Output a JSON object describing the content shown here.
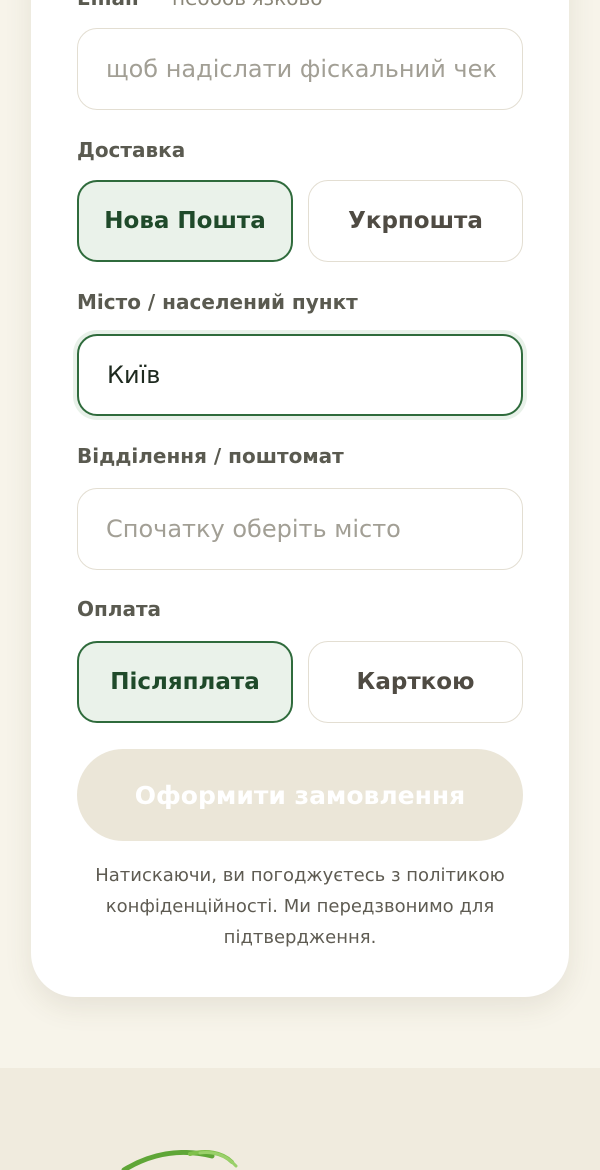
{
  "form": {
    "email": {
      "label": "Email",
      "optional_note": "— необов'язково",
      "placeholder": "щоб надіслати фіскальний чек"
    },
    "delivery": {
      "label": "Доставка",
      "options": [
        "Нова Пошта",
        "Укрпошта"
      ],
      "selected": "Нова Пошта"
    },
    "city": {
      "label": "Місто / населений пункт",
      "value": "Київ"
    },
    "branch": {
      "label": "Відділення / поштомат",
      "placeholder": "Спочатку оберіть місто"
    },
    "payment": {
      "label": "Оплата",
      "options": [
        "Післяплата",
        "Карткою"
      ],
      "selected": "Післяплата"
    },
    "submit_label": "Оформити замовлення",
    "disclaimer": "Натискаючи, ви погоджуєтесь з політикою конфіденційності. Ми передзвонимо для підтвердження."
  },
  "colors": {
    "accent": "#2f6b3c",
    "selected_bg": "#eaf2ea",
    "page_bg": "#f7f4ea",
    "button_disabled": "#ebe6d8"
  }
}
